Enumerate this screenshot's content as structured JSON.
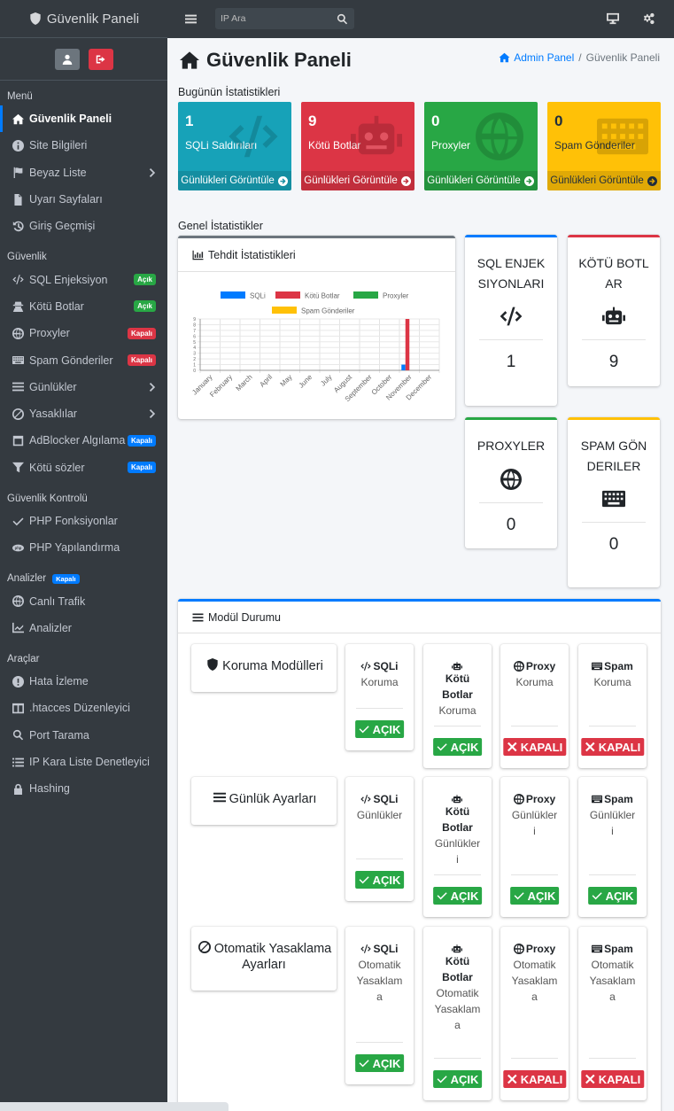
{
  "brand": {
    "title": "Güvenlik Paneli"
  },
  "sidebar": {
    "sections": [
      {
        "label": "Menü",
        "items": [
          {
            "label": "Güvenlik Paneli",
            "icon": "home-icon",
            "active": true
          },
          {
            "label": "Site Bilgileri",
            "icon": "info-icon"
          },
          {
            "label": "Beyaz Liste",
            "icon": "flag-icon",
            "chevron": true
          },
          {
            "label": "Uyarı Sayfaları",
            "icon": "file-icon"
          },
          {
            "label": "Giriş Geçmişi",
            "icon": "history-icon"
          }
        ]
      },
      {
        "label": "Güvenlik",
        "items": [
          {
            "label": "SQL Enjeksiyon",
            "icon": "code-icon",
            "badge": "Açık",
            "badge_color": "green"
          },
          {
            "label": "Kötü Botlar",
            "icon": "user-secret-icon",
            "badge": "Açık",
            "badge_color": "green"
          },
          {
            "label": "Proxyler",
            "icon": "globe-icon",
            "badge": "Kapalı",
            "badge_color": "red"
          },
          {
            "label": "Spam Gönderiler",
            "icon": "keyboard-icon",
            "badge": "Kapalı",
            "badge_color": "red"
          },
          {
            "label": "Günlükler",
            "icon": "list-icon",
            "chevron": true
          },
          {
            "label": "Yasaklılar",
            "icon": "ban-icon",
            "chevron": true
          },
          {
            "label": "AdBlocker Algılama",
            "icon": "window-icon",
            "badge": "Kapalı",
            "badge_color": "blue"
          },
          {
            "label": "Kötü sözler",
            "icon": "filter-icon",
            "badge": "Kapalı",
            "badge_color": "blue"
          }
        ]
      },
      {
        "label": "Güvenlik Kontrolü",
        "items": [
          {
            "label": "PHP Fonksiyonlar",
            "icon": "check-icon"
          },
          {
            "label": "PHP Yapılandırma",
            "icon": "php-icon"
          }
        ]
      },
      {
        "label": "Analizler",
        "badge": "Kapalı",
        "items": [
          {
            "label": "Canlı Trafik",
            "icon": "globe-icon"
          },
          {
            "label": "Analizler",
            "icon": "line-chart-icon"
          }
        ]
      },
      {
        "label": "Araçlar",
        "items": [
          {
            "label": "Hata İzleme",
            "icon": "exclamation-icon"
          },
          {
            "label": ".htacces Düzenleyici",
            "icon": "columns-icon"
          },
          {
            "label": "Port Tarama",
            "icon": "search-icon"
          },
          {
            "label": "IP Kara Liste Denetleyici",
            "icon": "list-ul-icon"
          },
          {
            "label": "Hashing",
            "icon": "lock-icon"
          }
        ]
      }
    ]
  },
  "topbar": {
    "search_placeholder": "IP Ara"
  },
  "header": {
    "title": "Güvenlik Paneli",
    "breadcrumb_home": "Admin Panel",
    "breadcrumb_sep": "/",
    "breadcrumb_current": "Güvenlik Paneli"
  },
  "today": {
    "label": "Bugünün İstatistikleri",
    "boxes": [
      {
        "count": "1",
        "label": "SQLi Saldırıları",
        "footer": "Günlükleri Görüntüle",
        "color": "#17a2b8",
        "icon": "code-icon"
      },
      {
        "count": "9",
        "label": "Kötü Botlar",
        "footer": "Günlükleri Görüntüle",
        "color": "#dc3545",
        "icon": "robot-icon"
      },
      {
        "count": "0",
        "label": "Proxyler",
        "footer": "Günlükleri Görüntüle",
        "color": "#28a745",
        "icon": "globe-icon"
      },
      {
        "count": "0",
        "label": "Spam Gönderiler",
        "footer": "Günlükleri Görüntüle",
        "color": "#ffc107",
        "icon": "keyboard-icon"
      }
    ]
  },
  "general": {
    "label": "Genel İstatistikler",
    "chart_title": "Tehdit İstatistikleri",
    "cards": [
      {
        "title": "SQL ENJEKSIYONLARI",
        "value": "1",
        "color": "#007bff",
        "icon": "code-icon"
      },
      {
        "title": "KÖTÜ BOTLAR",
        "value": "9",
        "color": "#dc3545",
        "icon": "robot-icon"
      },
      {
        "title": "PROXYLER",
        "value": "0",
        "color": "#28a745",
        "icon": "globe-icon"
      },
      {
        "title": "SPAM GÖNDERILER",
        "value": "0",
        "color": "#ffc107",
        "icon": "keyboard-icon"
      }
    ]
  },
  "chart_data": {
    "type": "bar",
    "categories": [
      "January",
      "February",
      "March",
      "April",
      "May",
      "June",
      "July",
      "August",
      "September",
      "October",
      "November",
      "December"
    ],
    "series": [
      {
        "name": "SQLi",
        "color": "#007bff",
        "values": [
          0,
          0,
          0,
          0,
          0,
          0,
          0,
          0,
          0,
          0,
          1,
          0
        ]
      },
      {
        "name": "Kötü Botlar",
        "color": "#dc3545",
        "values": [
          0,
          0,
          0,
          0,
          0,
          0,
          0,
          0,
          0,
          0,
          9,
          0
        ]
      },
      {
        "name": "Proxyler",
        "color": "#28a745",
        "values": [
          0,
          0,
          0,
          0,
          0,
          0,
          0,
          0,
          0,
          0,
          0,
          0
        ]
      },
      {
        "name": "Spam Gönderiler",
        "color": "#ffc107",
        "values": [
          0,
          0,
          0,
          0,
          0,
          0,
          0,
          0,
          0,
          0,
          0,
          0
        ]
      }
    ],
    "ylim": [
      0,
      9
    ],
    "yticks": [
      0,
      1,
      2,
      3,
      4,
      5,
      6,
      7,
      8,
      9
    ],
    "grid": true,
    "legend": "top"
  },
  "modules": {
    "title": "Modül Durumu",
    "rows": [
      {
        "title": "Koruma Modülleri",
        "icon": "shield-icon",
        "items": [
          {
            "name": "SQLi",
            "icon": "code-icon",
            "sub": "Koruma",
            "status": "AÇIK",
            "on": true
          },
          {
            "name": "Kötü Botlar",
            "icon": "robot-icon",
            "sub": "Koruma",
            "status": "AÇIK",
            "on": true
          },
          {
            "name": "Proxy",
            "icon": "globe-icon",
            "sub": "Koruma",
            "status": "KAPALI",
            "on": false
          },
          {
            "name": "Spam",
            "icon": "keyboard-icon",
            "sub": "Koruma",
            "status": "KAPALI",
            "on": false
          }
        ]
      },
      {
        "title": "Günlük Ayarları",
        "icon": "list-icon",
        "items": [
          {
            "name": "SQLi",
            "icon": "code-icon",
            "sub": "Günlükler",
            "status": "AÇIK",
            "on": true
          },
          {
            "name": "Kötü Botlar",
            "icon": "robot-icon",
            "sub": "Günlükleri",
            "status": "AÇIK",
            "on": true
          },
          {
            "name": "Proxy",
            "icon": "globe-icon",
            "sub": "Günlükleri",
            "status": "AÇIK",
            "on": true
          },
          {
            "name": "Spam",
            "icon": "keyboard-icon",
            "sub": "Günlükleri",
            "status": "AÇIK",
            "on": true
          }
        ]
      },
      {
        "title": "Otomatik Yasaklama Ayarları",
        "icon": "ban-icon",
        "items": [
          {
            "name": "SQLi",
            "icon": "code-icon",
            "sub": "Otomatik Yasaklama",
            "status": "AÇIK",
            "on": true
          },
          {
            "name": "Kötü Botlar",
            "icon": "robot-icon",
            "sub": "Otomatik Yasaklama",
            "status": "AÇIK",
            "on": true
          },
          {
            "name": "Proxy",
            "icon": "globe-icon",
            "sub": "Otomatik Yasaklama",
            "status": "KAPALI",
            "on": false
          },
          {
            "name": "Spam",
            "icon": "keyboard-icon",
            "sub": "Otomatik Yasaklama",
            "status": "KAPALI",
            "on": false
          }
        ]
      }
    ]
  }
}
